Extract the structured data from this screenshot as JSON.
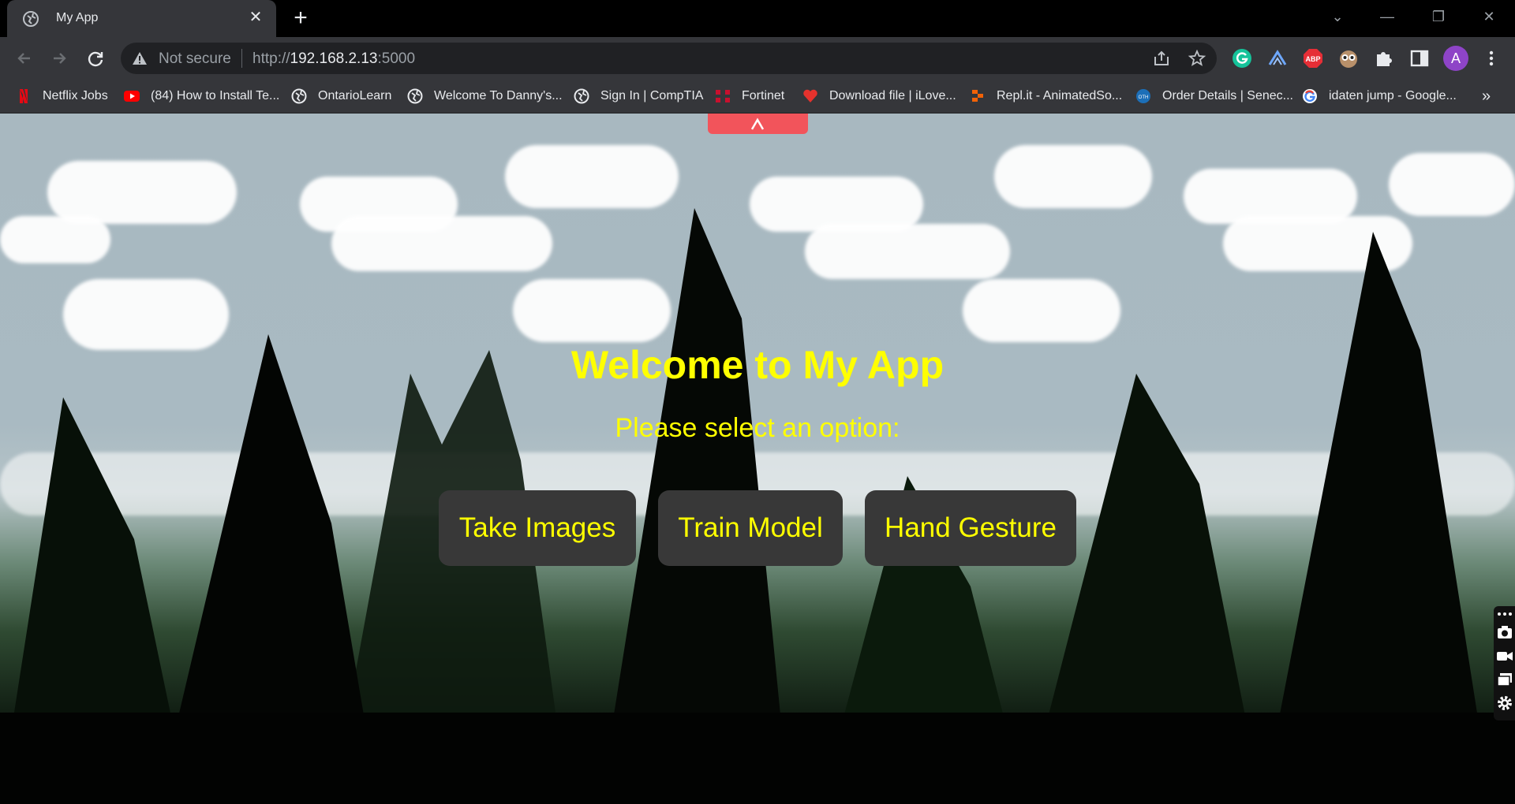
{
  "browser": {
    "tab": {
      "title": "My App",
      "close_label": "✕"
    },
    "new_tab_label": "+",
    "window_controls": {
      "list": "⌄",
      "minimize": "—",
      "restore": "❐",
      "close": "✕"
    },
    "omnibox": {
      "security_text": "Not secure",
      "url_scheme": "http://",
      "url_host": "192.168.2.13",
      "url_port": ":5000"
    },
    "profile_initial": "A",
    "bookmarks": [
      {
        "label": "Netflix Jobs",
        "icon": "netflix-icon"
      },
      {
        "label": "(84) How to Install Te...",
        "icon": "youtube-icon"
      },
      {
        "label": "OntarioLearn",
        "icon": "globe-icon"
      },
      {
        "label": "Welcome To Danny's...",
        "icon": "globe-icon"
      },
      {
        "label": "Sign In | CompTIA",
        "icon": "globe-icon"
      },
      {
        "label": "Fortinet",
        "icon": "fortinet-icon"
      },
      {
        "label": "Download file | iLove...",
        "icon": "heart-icon"
      },
      {
        "label": "Repl.it - AnimatedSo...",
        "icon": "replit-icon"
      },
      {
        "label": "Order Details | Senec...",
        "icon": "oth-icon"
      },
      {
        "label": "idaten jump - Google...",
        "icon": "google-icon"
      }
    ],
    "bookmarks_overflow": "»"
  },
  "page": {
    "title": "Welcome to My App",
    "prompt": "Please select an option:",
    "buttons": [
      "Take Images",
      "Train Model",
      "Hand Gesture"
    ]
  },
  "colors": {
    "accent_text": "#ffff00",
    "button_bg": "#383838",
    "chrome_bg": "#35363a",
    "extension_tab": "#f2545b"
  }
}
